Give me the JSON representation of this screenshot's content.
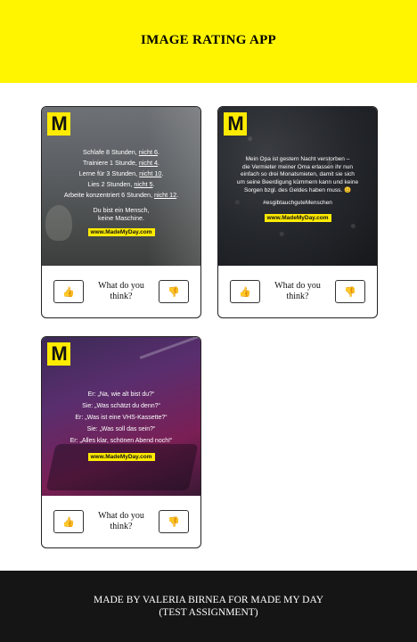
{
  "header": {
    "title": "IMAGE RATING APP"
  },
  "colors": {
    "header_bg": "#fff500",
    "footer_bg": "#151515",
    "brand_yellow": "#ffeb00"
  },
  "cards": [
    {
      "logo": "M",
      "lines": [
        {
          "pre": "Schlafe 8 Stunden, ",
          "ul": "nicht 6",
          "post": "."
        },
        {
          "pre": "Trainiere 1 Stunde, ",
          "ul": "nicht 4",
          "post": "."
        },
        {
          "pre": "Lerne für 3 Stunden, ",
          "ul": "nicht 10",
          "post": "."
        },
        {
          "pre": "Lies 2 Stunden, ",
          "ul": "nicht 5",
          "post": "."
        },
        {
          "pre": "Arbeite konzentriert 6 Stunden, ",
          "ul": "nicht 12",
          "post": "."
        }
      ],
      "closing": [
        "Du bist ein Mensch,",
        "keine Maschine."
      ],
      "site": "www.MadeMyDay.com",
      "prompt": "What do you think?",
      "like_icon": "thumbs-up-icon",
      "dislike_icon": "thumbs-down-icon"
    },
    {
      "logo": "M",
      "lines": [
        "Mein Opa ist gestern Nacht verstorben –",
        "die Vermieter meiner Oma erlassen ihr nun",
        "einfach so drei Monatsmieten, damit sie sich",
        "um seine Beerdigung kümmern kann und keine",
        "Sorgen bzgl. des Geldes haben muss. 😊"
      ],
      "hashtag": "#esgibtauchguteMenschen",
      "site": "www.MadeMyDay.com",
      "prompt": "What do you think?",
      "like_icon": "thumbs-up-icon",
      "dislike_icon": "thumbs-down-icon"
    },
    {
      "logo": "M",
      "lines": [
        "Er: „Na, wie alt bist du?“",
        "Sie: „Was schätzt du denn?“",
        "Er: „Was ist eine VHS-Kassette?“",
        "Sie: „Was soll das sein?“",
        "Er: „Alles klar, schönen Abend noch!“"
      ],
      "site": "www.MadeMyDay.com",
      "prompt": "What do you think?",
      "like_icon": "thumbs-up-icon",
      "dislike_icon": "thumbs-down-icon"
    }
  ],
  "footer": {
    "line1": "MADE BY VALERIA BIRNEA FOR MADE MY DAY",
    "line2": "(TEST ASSIGNMENT)"
  }
}
